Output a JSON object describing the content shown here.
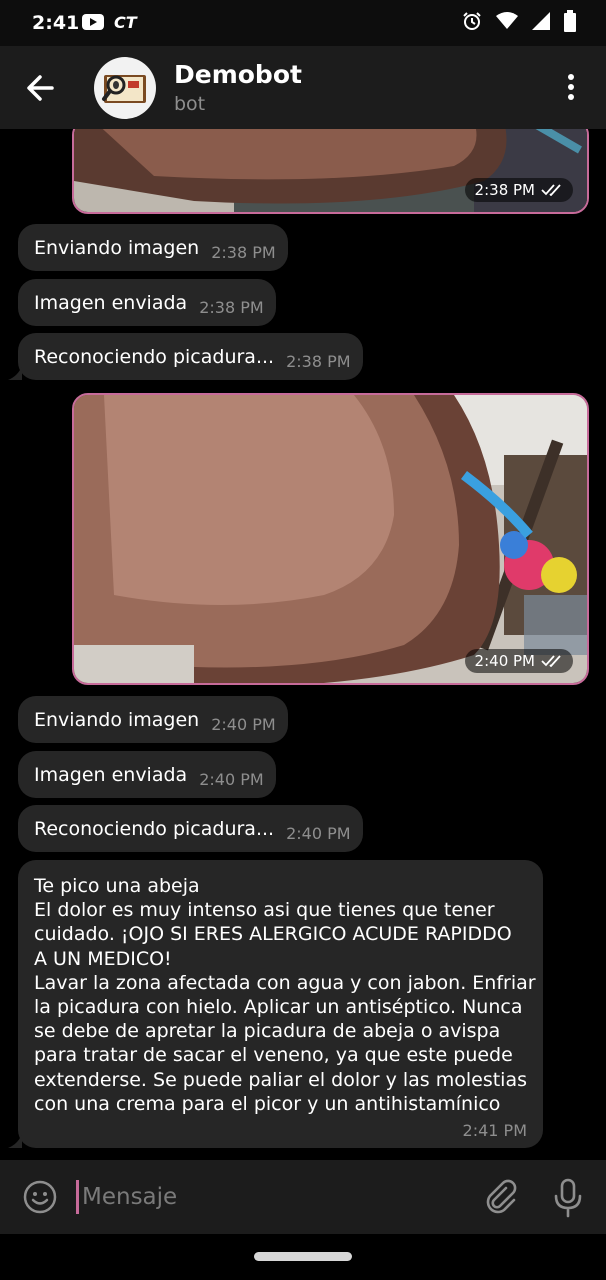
{
  "status_bar": {
    "time": "2:41",
    "carrier_logo": "CT"
  },
  "header": {
    "title": "Demobot",
    "subtitle": "bot"
  },
  "colors": {
    "accent": "#c76b9a",
    "bubble": "#262626",
    "header": "#1c1c1c",
    "background": "#000000"
  },
  "messages": {
    "photo1": {
      "time": "2:38 PM",
      "status": "read"
    },
    "m1": {
      "text": "Enviando imagen",
      "time": "2:38 PM"
    },
    "m2": {
      "text": "Imagen enviada",
      "time": "2:38 PM"
    },
    "m3": {
      "text": "Reconociendo picadura...",
      "time": "2:38 PM"
    },
    "photo2": {
      "time": "2:40 PM",
      "status": "read"
    },
    "m4": {
      "text": "Enviando imagen",
      "time": "2:40 PM"
    },
    "m5": {
      "text": "Imagen enviada",
      "time": "2:40 PM"
    },
    "m6": {
      "text": "Reconociendo picadura...",
      "time": "2:40 PM"
    },
    "m7": {
      "lines": [
        "Te pico una abeja",
        "El dolor es muy intenso asi que tienes que tener",
        "cuidado. ¡OJO SI ERES ALERGICO ACUDE RAPIDDO",
        "A UN MEDICO!",
        "Lavar la zona afectada con agua y con jabon. Enfriar",
        "la picadura con hielo. Aplicar un antiséptico. Nunca",
        "se debe de apretar la picadura de abeja o avispa",
        "para tratar de sacar el veneno, ya que este puede",
        "extenderse. Se puede paliar el dolor y las molestias",
        "con una crema para el picor y un antihistamínico"
      ],
      "time": "2:41 PM"
    }
  },
  "composer": {
    "placeholder": "Mensaje"
  },
  "icons": {
    "back": "arrow-left-icon",
    "menu": "more-vertical-icon",
    "emoji": "smile-icon",
    "attach": "paperclip-icon",
    "mic": "microphone-icon",
    "read": "double-check-icon"
  }
}
